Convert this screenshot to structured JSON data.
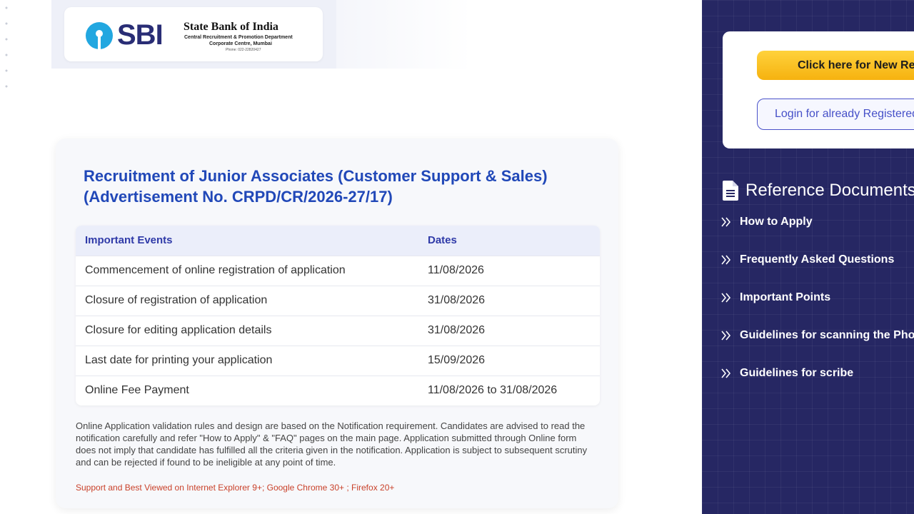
{
  "header": {
    "logo_text": "SBI",
    "bank_name": "State Bank of India",
    "department": "Central Recruitment & Promotion Department",
    "office": "Corporate Centre, Mumbai",
    "phone": "Phone: 022-22820427"
  },
  "recruitment": {
    "title_line1": "Recruitment of Junior Associates (Customer Support & Sales)",
    "title_line2": "(Advertisement No. CRPD/CR/2026-27/17)",
    "table": {
      "headers": [
        "Important Events",
        "Dates"
      ],
      "rows": [
        {
          "event": "Commencement of online registration of application",
          "date": "11/08/2026"
        },
        {
          "event": "Closure of registration of application",
          "date": "31/08/2026"
        },
        {
          "event": "Closure for editing application details",
          "date": "31/08/2026"
        },
        {
          "event": "Last date for printing your application",
          "date": "15/09/2026"
        },
        {
          "event": "Online Fee Payment",
          "date": "11/08/2026 to 31/08/2026"
        }
      ]
    },
    "note": "Online Application validation rules and design are based on the Notification requirement. Candidates are advised to read the notification carefully and refer \"How to Apply\" & \"FAQ\" pages on the main page. Application submitted through Online form does not imply that candidate has fulfilled all the criteria given in the notification. Application is subject to subsequent scrutiny and can be rejected if found to be ineligible at any point of time.",
    "support": "Support and Best Viewed on Internet Explorer 9+; Google Chrome 30+ ; Firefox 20+"
  },
  "sidebar": {
    "new_registration_label": "Click here for New Registration",
    "login_label": "Login for already Registered",
    "reference_title": "Reference Documents",
    "reference_icon": "document-icon",
    "links": [
      {
        "label": "How to Apply"
      },
      {
        "label": "Frequently Asked Questions"
      },
      {
        "label": "Important Points"
      },
      {
        "label": "Guidelines for scanning the Photo"
      },
      {
        "label": "Guidelines for scribe"
      }
    ]
  },
  "colors": {
    "title_blue": "#2148b8",
    "sidebar_bg": "#262763",
    "primary_yellow": "#f6b20f",
    "support_red": "#c9412a"
  }
}
